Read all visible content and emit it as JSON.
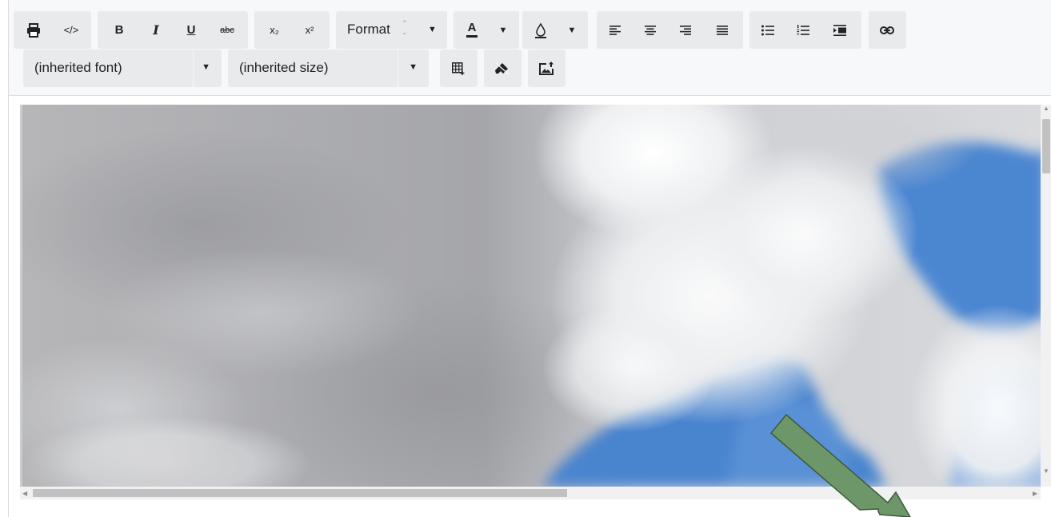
{
  "toolbar": {
    "format_label": "Format",
    "font_select_label": "(inherited font)",
    "size_select_label": "(inherited size)",
    "buttons": {
      "bold": "B",
      "italic": "I",
      "underline": "U",
      "strikethrough": "abc",
      "subscript": "x₂",
      "superscript": "x²",
      "font_color": "A",
      "caret": "▼",
      "spin_up": "⌃",
      "spin_down": "⌄",
      "view_source": "</>"
    }
  },
  "icons": [
    "print-icon",
    "source-code-icon",
    "font-color-icon",
    "background-color-icon",
    "align-left-icon",
    "align-center-icon",
    "align-right-icon",
    "align-justify-icon",
    "bullet-list-icon",
    "numbered-list-icon",
    "indent-icon",
    "link-icon",
    "insert-table-icon",
    "clear-format-icon",
    "insert-image-icon"
  ],
  "colors": {
    "toolbar_bg": "#f7f8f9",
    "button_group_bg": "#e9eaec",
    "annotation_arrow": "#6d9769",
    "annotation_arrow_stroke": "#3d5a3a",
    "sky_blue": "#4c86d1"
  }
}
